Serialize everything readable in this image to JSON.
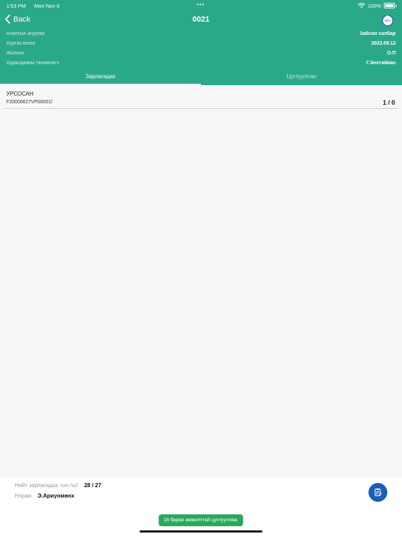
{
  "status_bar": {
    "time": "1:53 PM",
    "date": "Mon Nov 6",
    "dots": "•••",
    "battery": "100%"
  },
  "nav": {
    "back_label": "Back",
    "title": "0021",
    "progress_label": "96%",
    "progress_value": 0.96
  },
  "info": [
    {
      "label": "Ачилтын агуулах",
      "value": "Зайсан салбар"
    },
    {
      "label": "Хүргэх огноо",
      "value": "2023.09.12"
    },
    {
      "label": "Жолооч",
      "value": "О.П"
    },
    {
      "label": "Худалдааны төлөөлөгч",
      "value": "Г.Энхтайван"
    }
  ],
  "tabs": [
    {
      "label": "Зарлагадах",
      "active": true
    },
    {
      "label": "Цуглуулсан",
      "active": false
    }
  ],
  "items": [
    {
      "name": "УРСОСАН",
      "code": "F20000627VP00001/",
      "count": "1 / 0"
    }
  ],
  "footer": {
    "total_label": "Нийт зарлагадах тоо /ш/:",
    "total_value": "28 / 27",
    "checker_label": "Нярав:",
    "checker_value": "Э.Ариунмөнх"
  },
  "toast": "18 бараа амжилттай цуглууллаа.",
  "colors": {
    "header": "#2aa989",
    "fab": "#1a5fb5",
    "toast": "#2aa95e"
  },
  "icons": {
    "back": "chevron-left-icon",
    "fab": "clipboard-icon",
    "wifi": "wifi-icon",
    "battery": "battery-icon"
  }
}
